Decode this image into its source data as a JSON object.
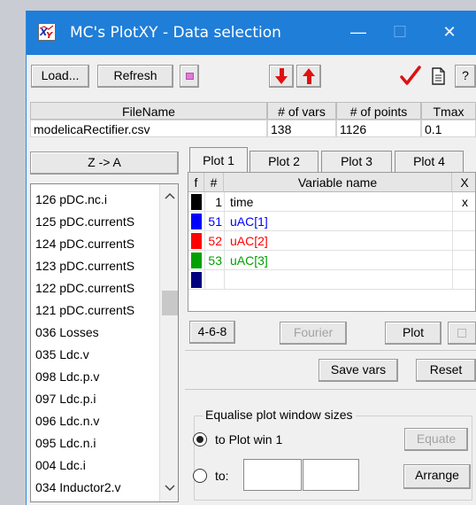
{
  "window": {
    "title": "MC's PlotXY - Data selection",
    "minimize": "—",
    "maximize": "☐",
    "close": "✕"
  },
  "toolbar": {
    "load_label": "Load...",
    "refresh_label": "Refresh",
    "help_label": "?"
  },
  "file_table": {
    "headers": [
      "FileName",
      "# of vars",
      "# of points",
      "Tmax"
    ],
    "row": [
      "modelicaRectifier.csv",
      "138",
      "1126",
      "0.1"
    ]
  },
  "sort_button": "Z -> A",
  "variables": [
    "126  pDC.nc.i",
    "125  pDC.currentS",
    "124  pDC.currentS",
    "123  pDC.currentS",
    "122  pDC.currentS",
    "121  pDC.currentS",
    "036  Losses",
    "035  Ldc.v",
    "098  Ldc.p.v",
    "097  Ldc.p.i",
    "096  Ldc.n.v",
    "095  Ldc.n.i",
    "004  Ldc.i",
    "034  Inductor2.v"
  ],
  "tabs": [
    "Plot 1",
    "Plot 2",
    "Plot 3",
    "Plot 4"
  ],
  "plot_grid": {
    "headers": [
      "f",
      "#",
      "Variable name",
      "X"
    ],
    "rows": [
      {
        "num": "1",
        "name": "time",
        "x": "x",
        "color": "#000000",
        "text_color": "#000000"
      },
      {
        "num": "51",
        "name": "uAC[1]",
        "x": "",
        "color": "#0000ff",
        "text_color": "#0000ff"
      },
      {
        "num": "52",
        "name": "uAC[2]",
        "x": "",
        "color": "#ff0000",
        "text_color": "#ff0000"
      },
      {
        "num": "53",
        "name": "uAC[3]",
        "x": "",
        "color": "#00a000",
        "text_color": "#00a000"
      },
      {
        "num": "",
        "name": "",
        "x": "",
        "color": "#000080",
        "text_color": "#000000"
      }
    ]
  },
  "actions": {
    "grid_468": "4-6-8",
    "fourier": "Fourier",
    "plot": "Plot",
    "save_vars": "Save vars",
    "reset": "Reset"
  },
  "equalise": {
    "title": "Equalise plot window sizes",
    "to_plot_win": "to Plot win 1",
    "to_label": "to:",
    "equate": "Equate",
    "arrange": "Arrange"
  }
}
